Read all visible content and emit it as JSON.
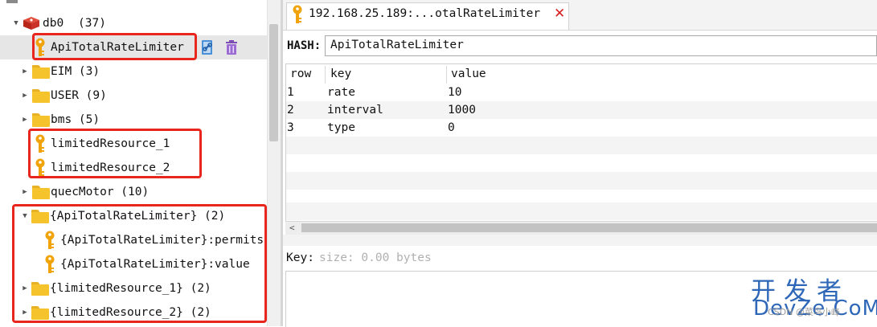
{
  "tree": {
    "db": {
      "name": "db0",
      "count": "(37)"
    },
    "items": [
      {
        "label": "ApiTotalRateLimiter",
        "kind": "key"
      },
      {
        "label": "EIM (3)",
        "kind": "folder"
      },
      {
        "label": "USER (9)",
        "kind": "folder"
      },
      {
        "label": "bms (5)",
        "kind": "folder"
      },
      {
        "label": "limitedResource_1",
        "kind": "key"
      },
      {
        "label": "limitedResource_2",
        "kind": "key"
      },
      {
        "label": "quecMotor (10)",
        "kind": "folder"
      },
      {
        "label": "{ApiTotalRateLimiter} (2)",
        "kind": "folder"
      },
      {
        "label": "{ApiTotalRateLimiter}:permits",
        "kind": "key"
      },
      {
        "label": "{ApiTotalRateLimiter}:value",
        "kind": "key"
      },
      {
        "label": "{limitedResource_1} (2)",
        "kind": "folder"
      },
      {
        "label": "{limitedResource_2} (2)",
        "kind": "folder"
      }
    ]
  },
  "tab": {
    "label": "192.168.25.189:...otalRateLimiter",
    "close": "✕"
  },
  "hash": {
    "label": "HASH:",
    "value": "ApiTotalRateLimiter"
  },
  "grid": {
    "headers": [
      "row",
      "key",
      "value"
    ],
    "rows": [
      {
        "row": "1",
        "key": "rate",
        "value": "10"
      },
      {
        "row": "2",
        "key": "interval",
        "value": "1000"
      },
      {
        "row": "3",
        "key": "type",
        "value": "0"
      }
    ]
  },
  "value_panel": {
    "key_label": "Key:",
    "placeholder": "size: 0.00 bytes"
  },
  "watermark": {
    "top": "开发者",
    "bottom": "DevZe.CoM",
    "sub": "CSDN @菜鸟小峰"
  },
  "colors": {
    "highlight": "#e8261d",
    "folder": "#f5c32c",
    "key_icon": "#f0a30a",
    "close": "#d62020"
  },
  "icons": [
    "redis-db-icon",
    "key-icon",
    "folder-icon",
    "copy-link-icon",
    "trash-icon",
    "chevron-left-icon"
  ]
}
